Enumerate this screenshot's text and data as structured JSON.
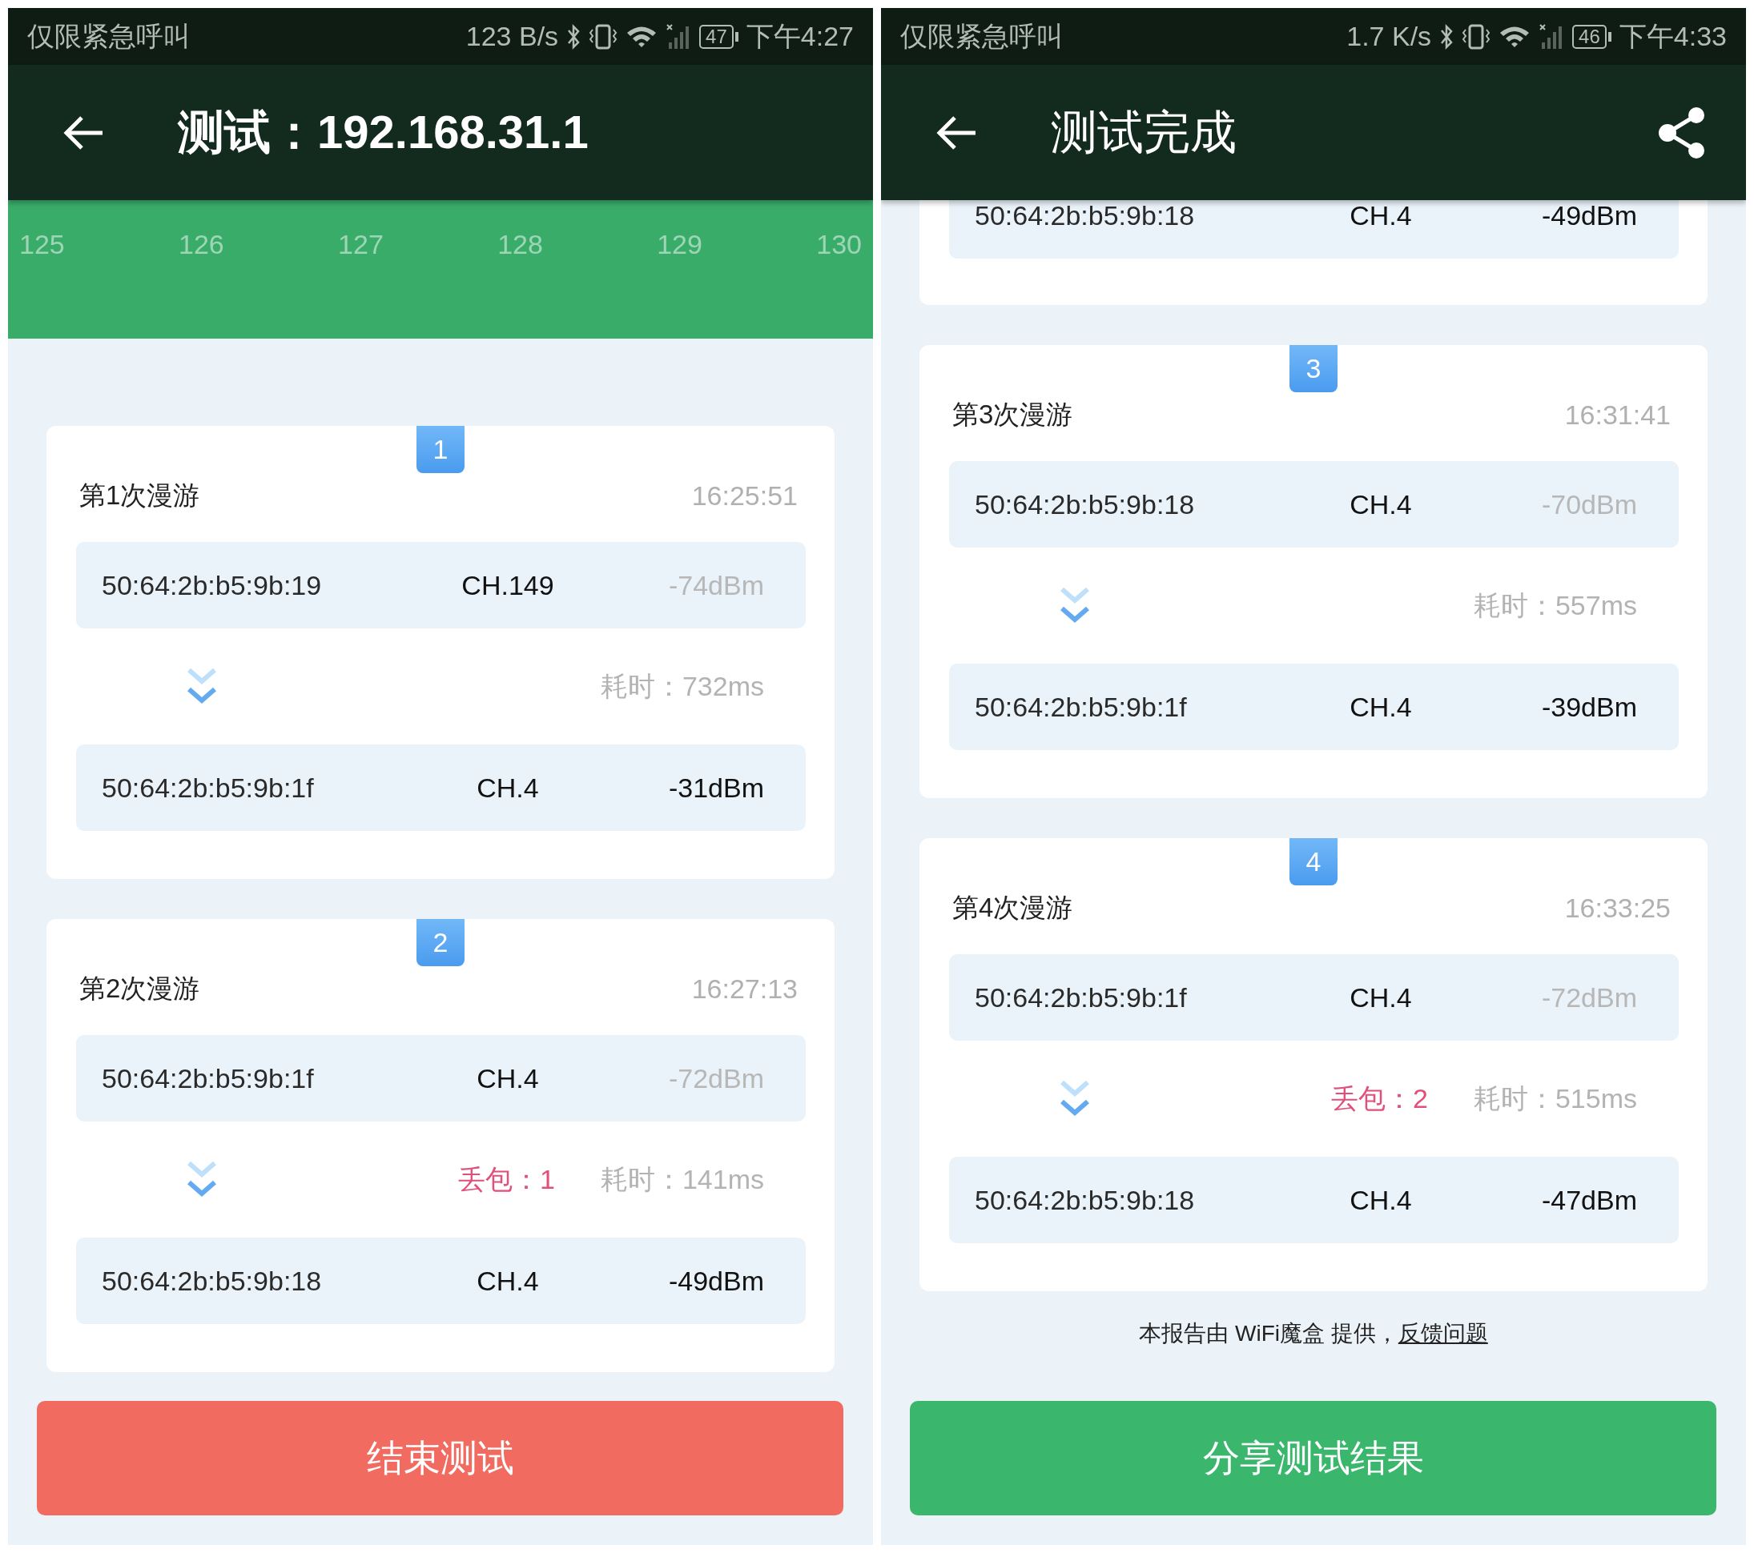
{
  "screens": [
    {
      "status_bar": {
        "carrier": "仅限紧急呼叫",
        "speed": "123 B/s",
        "battery": "47",
        "time": "下午4:27"
      },
      "app_bar": {
        "title": "测试：192.168.31.1",
        "share": false
      },
      "channel_axis": [
        "125",
        "126",
        "127",
        "128",
        "129",
        "130"
      ],
      "roams": [
        {
          "kind": "full",
          "badge": "1",
          "title": "第1次漫游",
          "time": "16:25:51",
          "from": {
            "mac": "50:64:2b:b5:9b:19",
            "channel": "CH.149",
            "signal": "-74dBm",
            "dim": true
          },
          "duration": "耗时：732ms",
          "to": {
            "mac": "50:64:2b:b5:9b:1f",
            "channel": "CH.4",
            "signal": "-31dBm",
            "dim": false
          }
        },
        {
          "kind": "full",
          "badge": "2",
          "title": "第2次漫游",
          "time": "16:27:13",
          "from": {
            "mac": "50:64:2b:b5:9b:1f",
            "channel": "CH.4",
            "signal": "-72dBm",
            "dim": true
          },
          "loss": "丢包：1",
          "duration": "耗时：141ms",
          "to": {
            "mac": "50:64:2b:b5:9b:18",
            "channel": "CH.4",
            "signal": "-49dBm",
            "dim": false
          }
        }
      ],
      "button": {
        "label": "结束测试",
        "kind": "stop"
      }
    },
    {
      "status_bar": {
        "carrier": "仅限紧急呼叫",
        "speed": "1.7 K/s",
        "battery": "46",
        "time": "下午4:33"
      },
      "app_bar": {
        "title": "测试完成",
        "share": true
      },
      "roams": [
        {
          "kind": "tail",
          "to": {
            "mac": "50:64:2b:b5:9b:18",
            "channel": "CH.4",
            "signal": "-49dBm",
            "dim": false
          }
        },
        {
          "kind": "full",
          "badge": "3",
          "title": "第3次漫游",
          "time": "16:31:41",
          "from": {
            "mac": "50:64:2b:b5:9b:18",
            "channel": "CH.4",
            "signal": "-70dBm",
            "dim": true
          },
          "duration": "耗时：557ms",
          "to": {
            "mac": "50:64:2b:b5:9b:1f",
            "channel": "CH.4",
            "signal": "-39dBm",
            "dim": false
          }
        },
        {
          "kind": "full",
          "badge": "4",
          "title": "第4次漫游",
          "time": "16:33:25",
          "from": {
            "mac": "50:64:2b:b5:9b:1f",
            "channel": "CH.4",
            "signal": "-72dBm",
            "dim": true
          },
          "loss": "丢包：2",
          "duration": "耗时：515ms",
          "to": {
            "mac": "50:64:2b:b5:9b:18",
            "channel": "CH.4",
            "signal": "-47dBm",
            "dim": false
          }
        }
      ],
      "footer": {
        "text": "本报告由 WiFi魔盒 提供，",
        "link": "反馈问题"
      },
      "button": {
        "label": "分享测试结果",
        "kind": "share"
      }
    }
  ]
}
